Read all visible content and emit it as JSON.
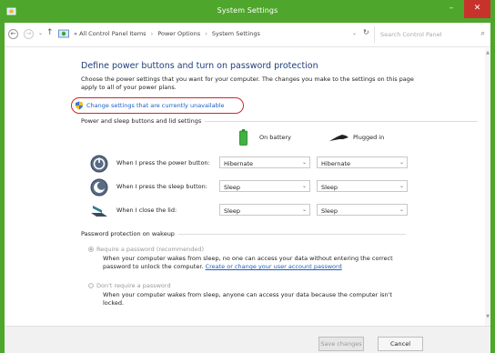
{
  "window": {
    "title": "System Settings",
    "min_label": "–",
    "max_label": "□",
    "close_label": "✕"
  },
  "address_bar": {
    "back": "←",
    "forward": "→",
    "dropdown": "⌄",
    "up": "↑",
    "crumb_prefix": "«",
    "crumbs": [
      "All Control Panel Items",
      "Power Options",
      "System Settings"
    ],
    "crumb_sep": "›",
    "path_dropdown": "⌄",
    "refresh": "↻",
    "search_placeholder": "Search Control Panel",
    "search_icon": "⌕"
  },
  "main": {
    "title": "Define power buttons and turn on password protection",
    "description": "Choose the power settings that you want for your computer. The changes you make to the settings on this page apply to all of your power plans.",
    "change_link": "Change settings that are currently unavailable",
    "section_power": "Power and sleep buttons and lid settings",
    "column_battery": "On battery",
    "column_plugged": "Plugged in",
    "rows": [
      {
        "label": "When I press the power button:",
        "battery": "Hibernate",
        "plugged": "Hibernate",
        "icon": "power-button-icon"
      },
      {
        "label": "When I press the sleep button:",
        "battery": "Sleep",
        "plugged": "Sleep",
        "icon": "sleep-button-icon"
      },
      {
        "label": "When I close the lid:",
        "battery": "Sleep",
        "plugged": "Sleep",
        "icon": "laptop-lid-icon"
      }
    ],
    "section_password": "Password protection on wakeup",
    "require_label": "Require a password (recommended)",
    "require_desc": "When your computer wakes from sleep, no one can access your data without entering the correct password to unlock the computer.",
    "require_link": "Create or change your user account password",
    "norequire_label": "Don't require a password",
    "norequire_desc": "When your computer wakes from sleep, anyone can access your data because the computer isn't locked."
  },
  "footer": {
    "save": "Save changes",
    "cancel": "Cancel"
  },
  "colors": {
    "title_bar": "#4fa62c",
    "close": "#c7332b",
    "highlight_circle": "#d4242a",
    "link": "#1a5ec7",
    "heading": "#1e3f7a"
  }
}
